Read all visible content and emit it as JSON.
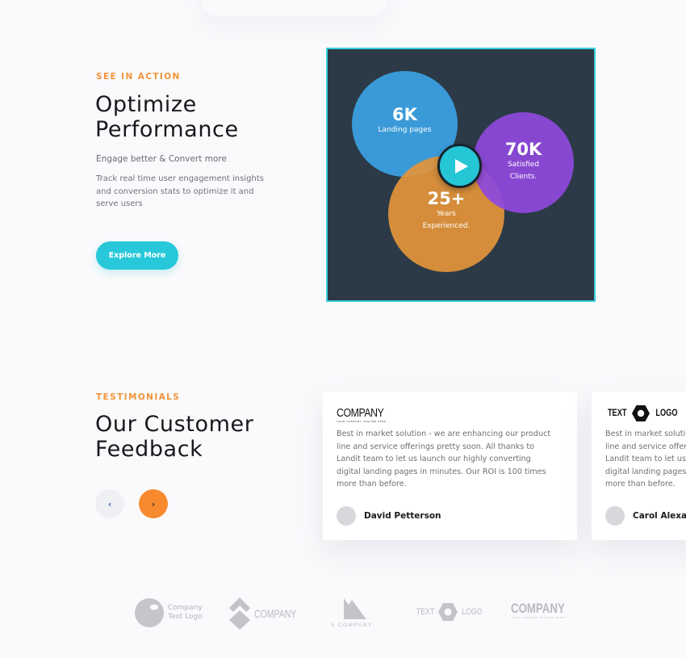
{
  "feature": {
    "eyebrow": "SEE IN ACTION",
    "title_line1": "Optimize",
    "title_line2": "Performance",
    "subtitle": "Engage better & Convert more",
    "description": "Track real time user engagement insights and conversion stats to optimize it and serve users",
    "cta_label": "Explore More",
    "video": {
      "stats": [
        {
          "value": "6K",
          "label_line1": "Landing pages",
          "label_line2": "",
          "color": "#3a9ad8"
        },
        {
          "value": "70K",
          "label_line1": "Satisfied",
          "label_line2": "Clients.",
          "color": "#8e48dc"
        },
        {
          "value": "25+",
          "label_line1": "Years",
          "label_line2": "Experienced.",
          "color": "#e2933a"
        }
      ],
      "play_icon": "play-icon",
      "accent": "#25c6d6",
      "background": "#2b3a46"
    }
  },
  "testimonials": {
    "eyebrow": "TESTIMONIALS",
    "title_line1": "Our Customer",
    "title_line2": "Feedback",
    "prev_icon": "chevron-left-icon",
    "next_icon": "chevron-right-icon",
    "prev_glyph": "‹",
    "next_glyph": "›",
    "cards": [
      {
        "logo_text": "COMPANY",
        "logo_tagline": "YOUR COMPANY TAGLINE HERE",
        "quote": "Best in market solution - we are enhancing our product line and service offerings pretty soon. All thanks to Landit team to let us launch our highly converting digital landing pages in minutes. Our ROI is 100 times more than before.",
        "author": "David Petterson"
      },
      {
        "logo_text_left": "TEXT",
        "logo_text_right": "LOGO",
        "quote": "Best in market solution - we are enhancing our product line and service offerings pretty soon. All thanks to Landit team to let us launch our highly converting digital landing pages in minutes. Our ROI is 100 times more than before.",
        "author": "Carol Alexander"
      }
    ]
  },
  "partners": [
    {
      "line1": "Company",
      "line2": "Text Logo"
    },
    {
      "text": "COMPANY"
    },
    {
      "text": "A COMPANY"
    },
    {
      "left": "TEXT",
      "right": "LOGO"
    },
    {
      "text": "COMPANY",
      "tagline": "YOUR COMPANY TAGLINE HERE"
    }
  ],
  "colors": {
    "accent_orange": "#f3933a",
    "accent_cyan": "#27c8d9",
    "next_button": "#f78a2e",
    "logo_gray": "#b9b9c0"
  }
}
